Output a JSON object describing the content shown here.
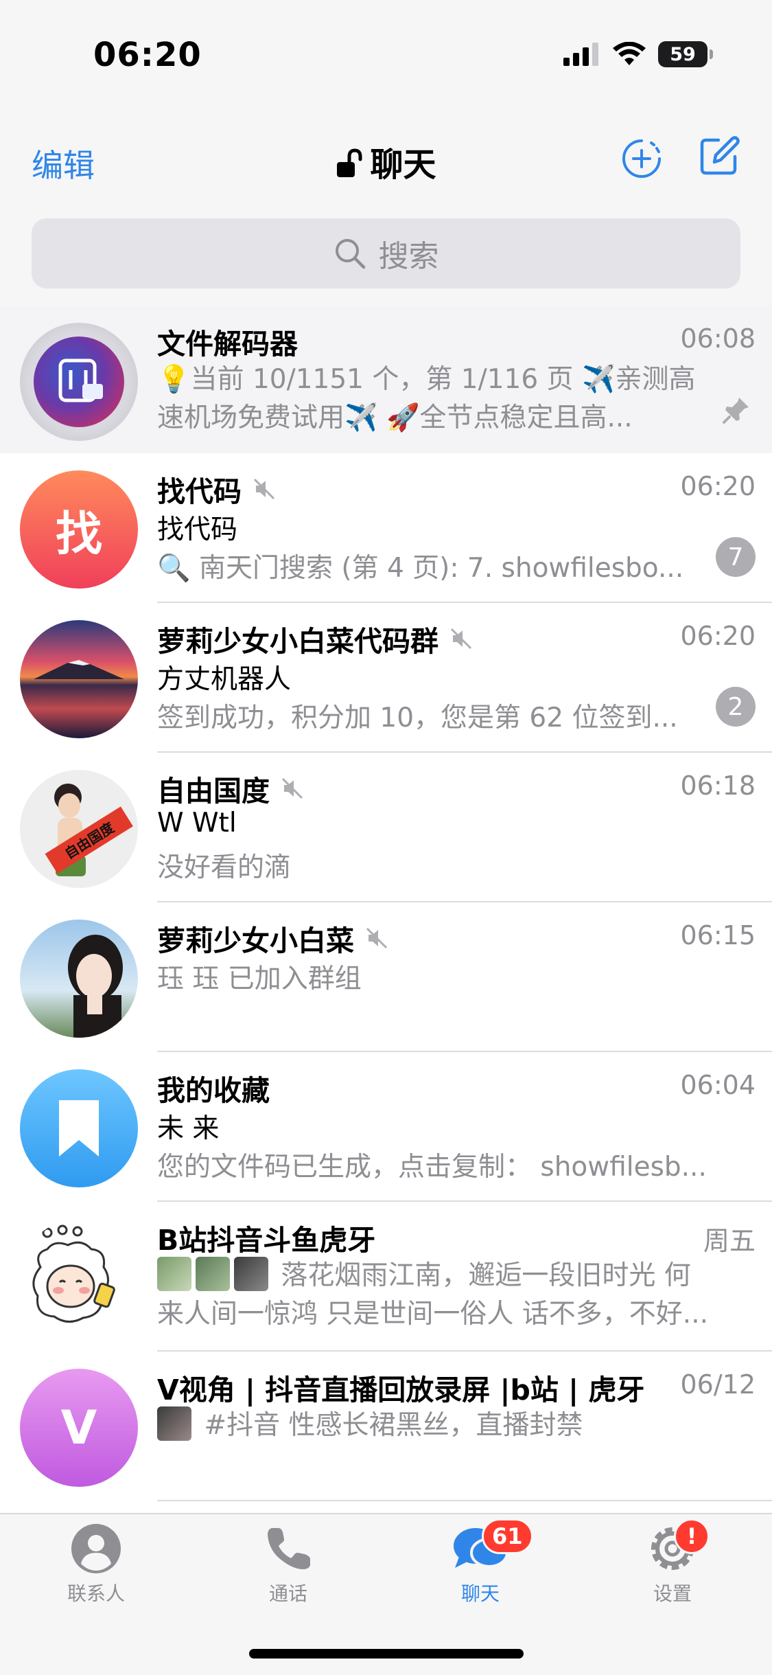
{
  "status_bar": {
    "time": "06:20",
    "battery": "59"
  },
  "nav": {
    "edit": "编辑",
    "title": "聊天"
  },
  "search": {
    "placeholder": "搜索"
  },
  "chats": [
    {
      "name": "文件解码器",
      "time": "06:08",
      "line1": "💡当前 10/1151 个，第 1/116 页 ✈️亲测高",
      "line2": "速机场免费试用✈️ 🚀全节点稳定且高...",
      "pinned": true
    },
    {
      "name": "找代码",
      "time": "06:20",
      "avatar_letter": "找",
      "sender": "找代码",
      "preview": "🔍 南天门搜索 (第 4 页): 7. showfilesbo...",
      "badge": "7",
      "muted": true
    },
    {
      "name": "萝莉少女小白菜代码群",
      "time": "06:20",
      "sender": "方丈机器人",
      "preview": "签到成功，积分加 10，您是第 62 位签到...",
      "badge": "2",
      "muted": true
    },
    {
      "name": "自由国度",
      "time": "06:18",
      "sender": "W Wtl",
      "preview": "没好看的滴",
      "muted": true,
      "avatar_text": "自由国度"
    },
    {
      "name": "萝莉少女小白菜",
      "time": "06:15",
      "sender": "珏 珏 已加入群组",
      "muted": true
    },
    {
      "name": "我的收藏",
      "time": "06:04",
      "sender": "未 来",
      "preview": "您的文件码已生成，点击复制： showfilesb..."
    },
    {
      "name": "B站抖音斗鱼虎牙",
      "time": "周五",
      "line1": "落花烟雨江南，邂逅一段旧时光 何",
      "line2": "来人间一惊鸿 只是世间一俗人 话不多，不好..."
    },
    {
      "name": "V视角 | 抖音直播回放录屏 |b站 | 虎牙",
      "time": "06/12",
      "avatar_letter": "V",
      "line1": "#抖音 性感长裙黑丝，直播封禁"
    }
  ],
  "tabs": [
    {
      "label": "联系人"
    },
    {
      "label": "通话"
    },
    {
      "label": "聊天",
      "badge": "61"
    },
    {
      "label": "设置",
      "badge": "!"
    }
  ]
}
